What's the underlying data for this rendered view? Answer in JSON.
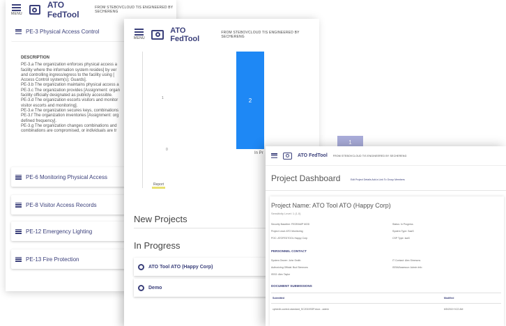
{
  "app": {
    "name": "ATO FedTool",
    "menu_label": "MENU",
    "tagline": "FROM STEBOVCLOUD TIS ENGINEERED BY SECHERENG",
    "tagline_back": "FROM STEBOVCLOUD TIS ENGINEERED BY SECHERENG"
  },
  "controls_panel": {
    "expanded": {
      "label": "PE-3 Physical Access Control",
      "desc_heading": "DESCRIPTION",
      "desc_lines": [
        "PE-3.a The organization enforces physical access a",
        "facility where the information system resides] by ver",
        "and controlling ingress/egress to the facility using [",
        "Access Control system(s); Guards].",
        "PE-3.b The organization maintains physical access a",
        "PE-3.c The organization provides [Assignment: organ",
        "facility officially designated as publicly accessible.",
        "PE-3.d The organization escorts visitors and monitor",
        "visitor escorts and monitoring].",
        "PE-3.e The organization secures keys, combinations",
        "PE-3.f The organization inventories [Assignment: org",
        "defined frequency].",
        "PE-3.g The organization changes combinations and",
        "combinations are compromised, or individuals are tr"
      ]
    },
    "items": [
      {
        "label": "PE-6 Monitoring Physical Access"
      },
      {
        "label": "PE-8 Visitor Access Records"
      },
      {
        "label": "PE-12 Emergency Lighting"
      },
      {
        "label": "PE-13 Fire Protection"
      }
    ]
  },
  "chart_data": {
    "type": "bar",
    "categories": [
      "In Pr",
      ""
    ],
    "values": [
      2,
      1
    ],
    "ylim": [
      0,
      2.8
    ],
    "y_ticks": [
      "1",
      "0"
    ],
    "legend": [
      "Report"
    ],
    "colors": [
      "#1e88f5",
      "#a9acd9"
    ]
  },
  "projects_panel": {
    "new_projects_title": "New Projects",
    "in_progress_title": "In Progress",
    "projects": [
      {
        "label": "ATO Tool ATO (Happy Corp)"
      },
      {
        "label": "Demo"
      }
    ]
  },
  "dashboard": {
    "title": "Project Dashboard",
    "links": "Edit Project Details   Add a Link To Group Members",
    "project_name": "Project Name: ATO Tool ATO (Happy Corp)",
    "subtitle": "Sensitivity Level: 1 (1.0)",
    "fields_left": [
      "Security Baseline: FEDRAMP MOD",
      "Project Lead: ATO Monitoring",
      "POC: ATOFEDTOOL Happy Corp"
    ],
    "fields_right": [
      "Status: In Progress",
      "System Type: SaaS",
      "CSP Type: IaaS"
    ],
    "section1": "PERSONNEL CONTACT",
    "contacts_left": [
      "System Owner: John Smith",
      "Authorizing Official: Bud Simmons",
      "ISSO: Alex Taylor"
    ],
    "contacts_right": [
      "IT Contact: Alex Simmons",
      "ISSM/Assessor: Admin Info"
    ],
    "section2": "DOCUMENT SUBMISSIONS",
    "table_head_left": "Submitted",
    "table_head_right": "Modified",
    "table_row_left": "cyberdb-control-standard_SC2019SSP.docx - admin",
    "table_row_right": "6/5/2019 9:22 AM"
  }
}
